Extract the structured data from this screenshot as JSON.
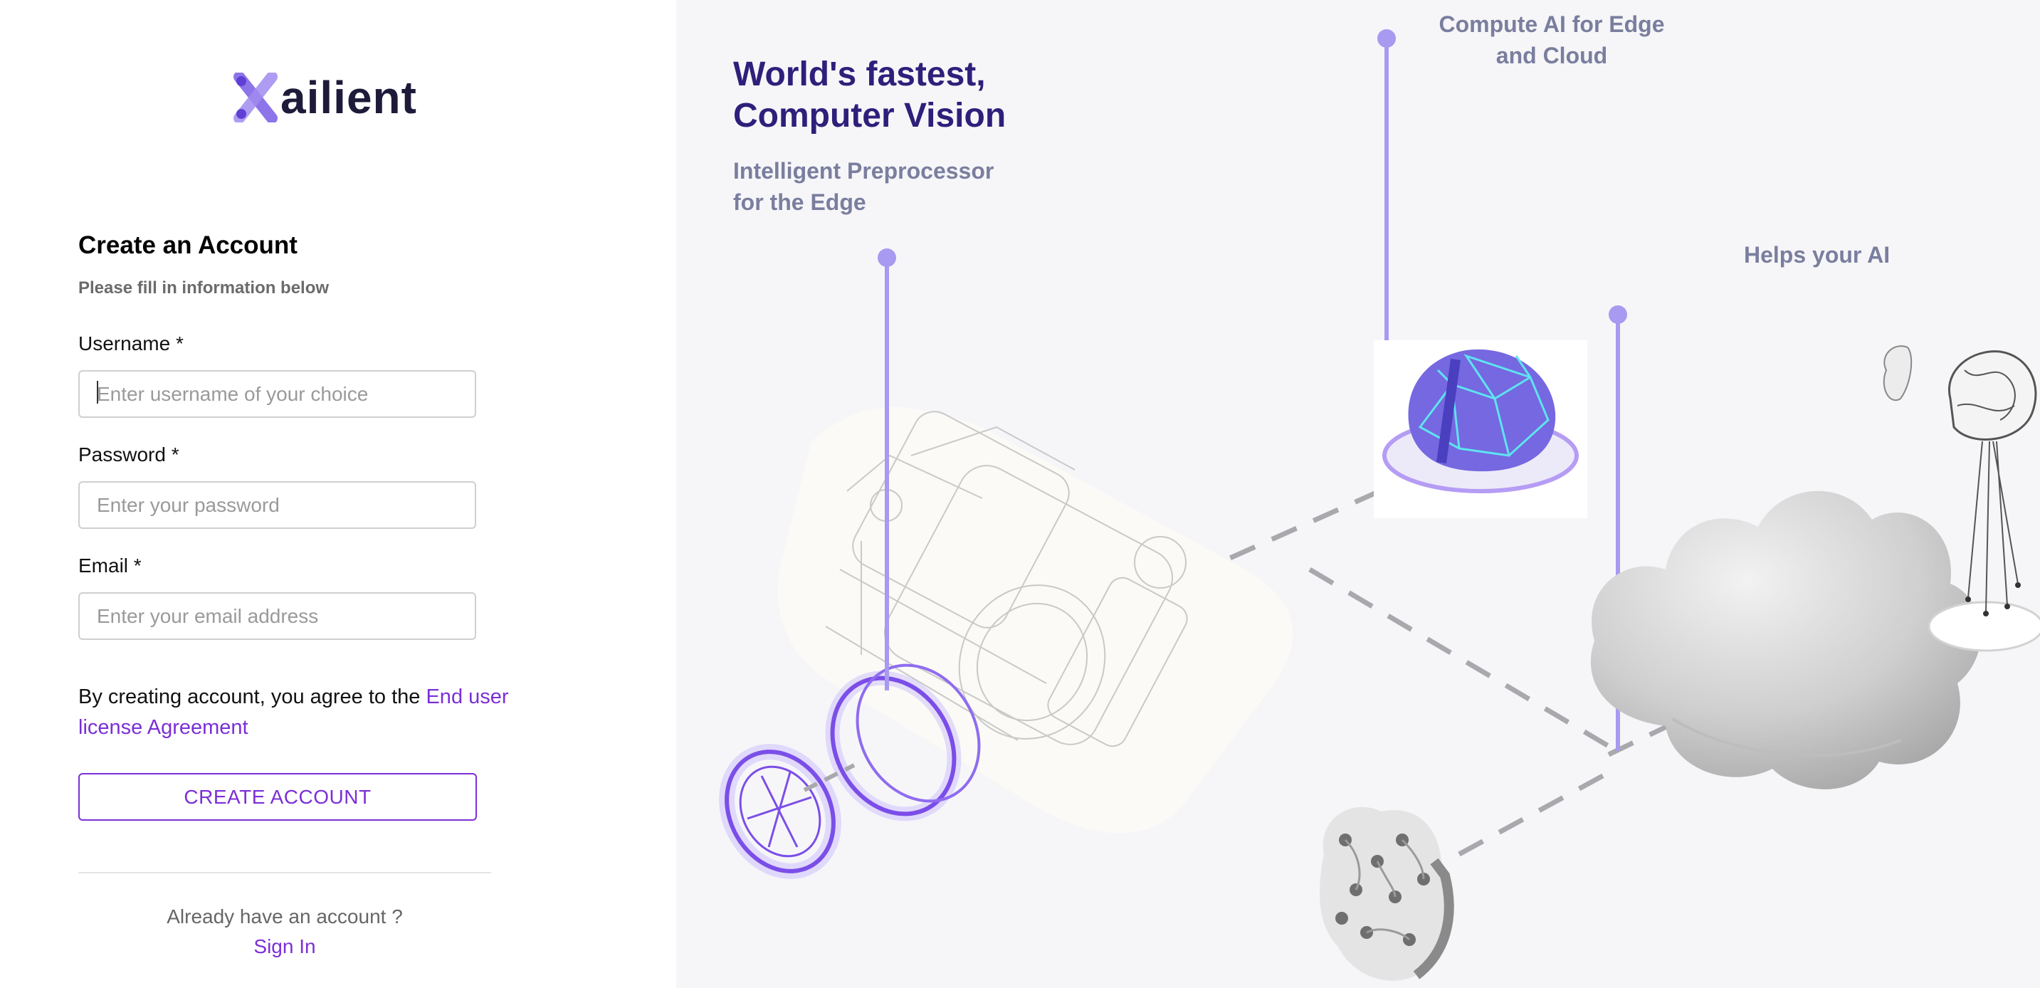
{
  "brand": {
    "name": "ailient",
    "mark": "X"
  },
  "form": {
    "title": "Create an Account",
    "subtitle": "Please fill in information below",
    "username": {
      "label": "Username *",
      "placeholder": "Enter username of your choice",
      "value": ""
    },
    "password": {
      "label": "Password *",
      "placeholder": "Enter your password",
      "value": ""
    },
    "email": {
      "label": "Email *",
      "placeholder": "Enter your email address",
      "value": ""
    },
    "agreement_text": "By creating account, you agree to the ",
    "agreement_link": "End user license Agreement",
    "submit_label": "CREATE ACCOUNT",
    "already_text": "Already have an account ?",
    "signin_label": "Sign In"
  },
  "hero": {
    "title_line1": "World's fastest,",
    "title_line2": "Computer Vision",
    "subtitle_line1": "Intelligent Preprocessor",
    "subtitle_line2": "for the Edge",
    "callout_compute_line1": "Compute AI for Edge",
    "callout_compute_line2": "and Cloud",
    "callout_helps": "Helps your AI"
  },
  "colors": {
    "accent": "#7b2fd6",
    "hero_title": "#2f1f7a",
    "muted_heading": "#7a7e9e",
    "callout_line": "#a79af0",
    "panel_bg": "#f6f6f9",
    "logo_mark": "#7b5ce6"
  },
  "icons": [
    "brand-x-mark-icon",
    "camera-illustration",
    "lens-ring-icon",
    "brain-chip-illustration",
    "cloud-illustration",
    "brain-tree-illustration",
    "circuit-chip-illustration"
  ]
}
